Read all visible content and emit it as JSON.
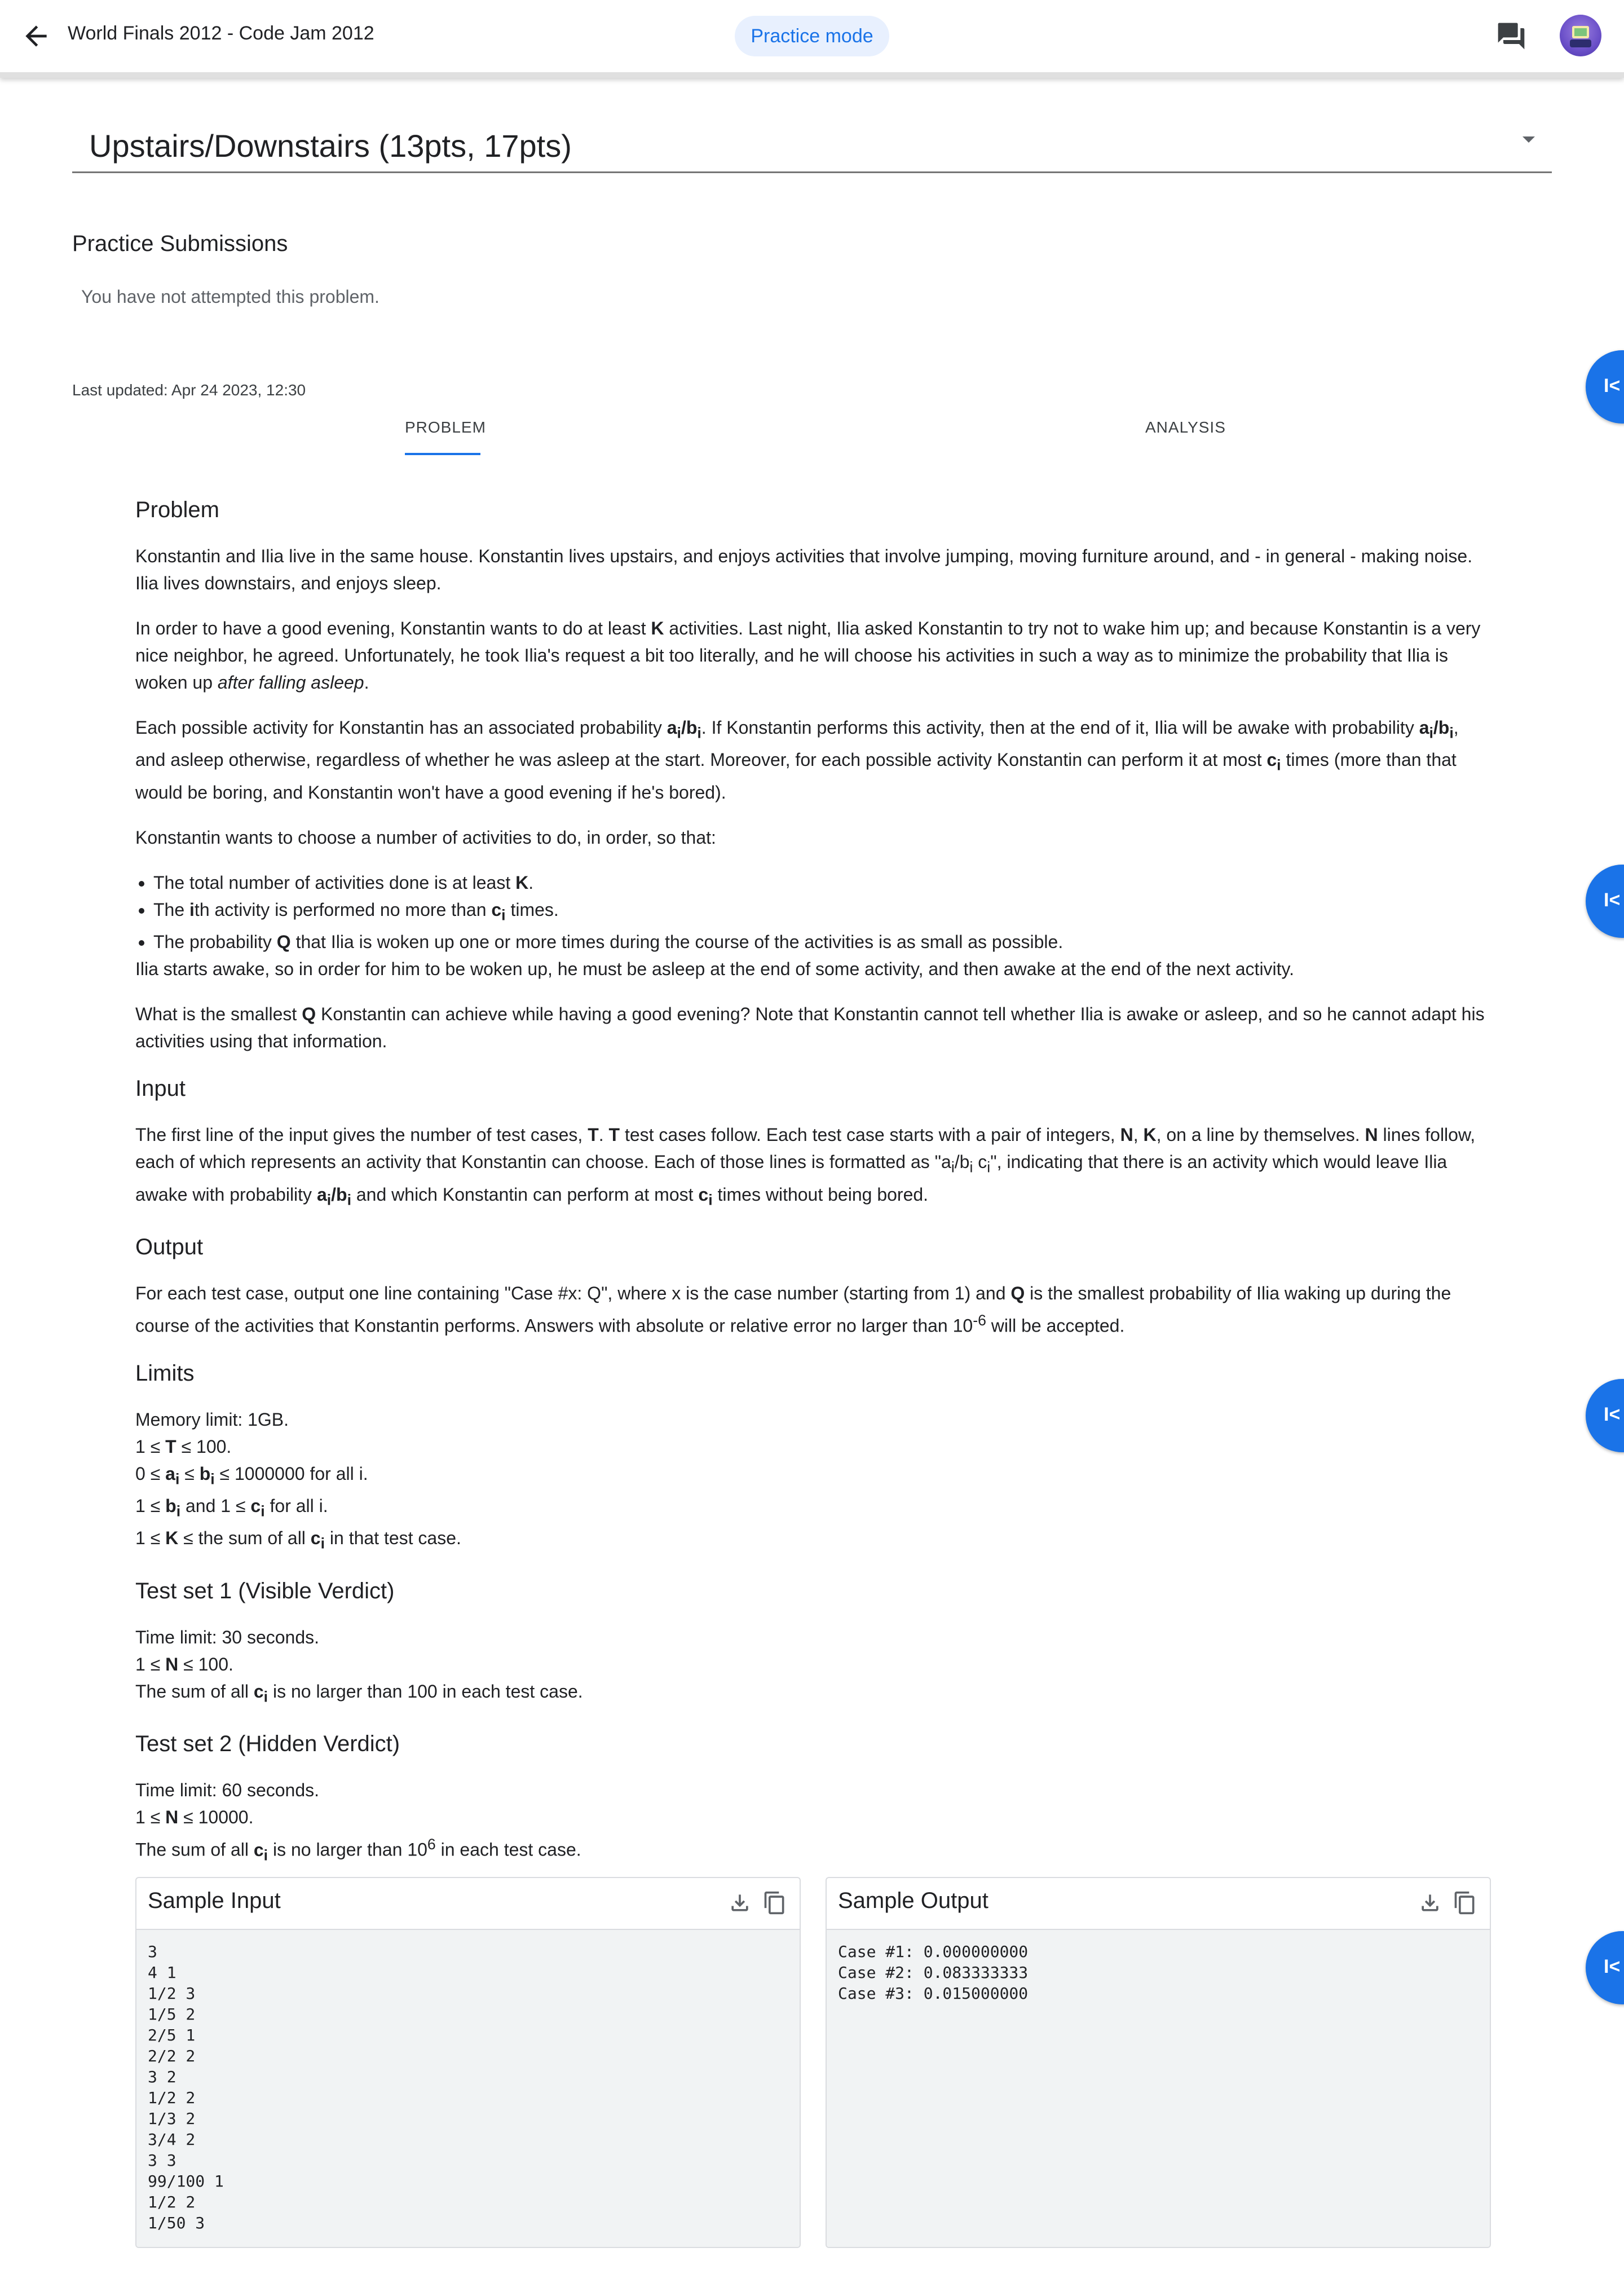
{
  "header": {
    "title": "World Finals 2012 - Code Jam 2012",
    "mode_chip": "Practice mode",
    "back_icon": "arrow-back-icon",
    "chat_icon": "chat-icon"
  },
  "problem_selector": {
    "title": "Upstairs/Downstairs (13pts, 17pts)"
  },
  "submissions": {
    "heading": "Practice Submissions",
    "empty_text": "You have not attempted this problem."
  },
  "last_updated": "Last updated: Apr 24 2023, 12:30",
  "tabs": [
    {
      "label": "PROBLEM",
      "active": true
    },
    {
      "label": "ANALYSIS",
      "active": false
    }
  ],
  "side_buttons": [
    {
      "icon": "collapse-icon"
    },
    {
      "icon": "collapse-icon"
    },
    {
      "icon": "collapse-icon"
    },
    {
      "icon": "collapse-icon"
    }
  ],
  "colors": {
    "accent": "#1a73e8",
    "chip_bg": "#e8f0fe",
    "code_bg": "#f1f3f4"
  },
  "sections": {
    "problem_h": "Problem",
    "input_h": "Input",
    "output_h": "Output",
    "limits_h": "Limits",
    "ts1_h": "Test set 1 (Visible Verdict)",
    "ts2_h": "Test set 2 (Hidden Verdict)",
    "sample_h": "Sample"
  },
  "sample": {
    "input_title": "Sample Input",
    "output_title": "Sample Output",
    "input_text": "3\n4 1\n1/2 3\n1/5 2\n2/5 1\n2/2 2\n3 2\n1/2 2\n1/3 2\n3/4 2\n3 3\n99/100 1\n1/2 2\n1/50 3",
    "output_text": "Case #1: 0.000000000\nCase #2: 0.083333333\nCase #3: 0.015000000"
  }
}
